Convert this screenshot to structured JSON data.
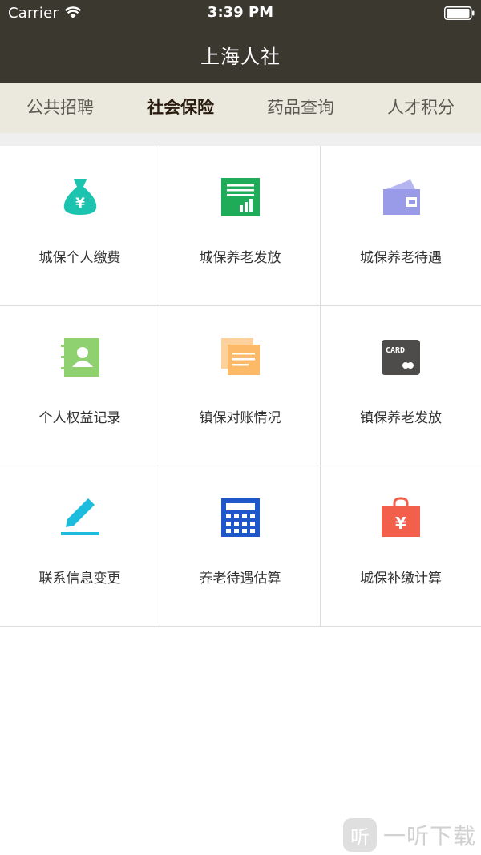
{
  "status_bar": {
    "carrier": "Carrier",
    "time": "3:39 PM"
  },
  "header": {
    "title": "上海人社"
  },
  "tabs": [
    {
      "label": "公共招聘",
      "active": false
    },
    {
      "label": "社会保险",
      "active": true
    },
    {
      "label": "药品查询",
      "active": false
    },
    {
      "label": "人才积分",
      "active": false
    }
  ],
  "grid": {
    "items": [
      {
        "label": "城保个人缴费",
        "icon": "money-bag-icon",
        "color": "#1cc4b0"
      },
      {
        "label": "城保养老发放",
        "icon": "report-chart-icon",
        "color": "#1fac58"
      },
      {
        "label": "城保养老待遇",
        "icon": "wallet-icon",
        "color": "#9a9be8"
      },
      {
        "label": "个人权益记录",
        "icon": "contact-book-icon",
        "color": "#8fd071"
      },
      {
        "label": "镇保对账情况",
        "icon": "documents-icon",
        "color": "#fcb968"
      },
      {
        "label": "镇保养老发放",
        "icon": "card-icon",
        "color": "#4e4c4b"
      },
      {
        "label": "联系信息变更",
        "icon": "pencil-icon",
        "color": "#1cbcdc"
      },
      {
        "label": "养老待遇估算",
        "icon": "calculator-icon",
        "color": "#1f56c9"
      },
      {
        "label": "城保补缴计算",
        "icon": "shopping-bag-icon",
        "color": "#f2604b"
      }
    ],
    "card_text": "CARD",
    "currency_symbol": "¥"
  },
  "watermark": {
    "logo_char": "听",
    "text": "一听下载"
  }
}
